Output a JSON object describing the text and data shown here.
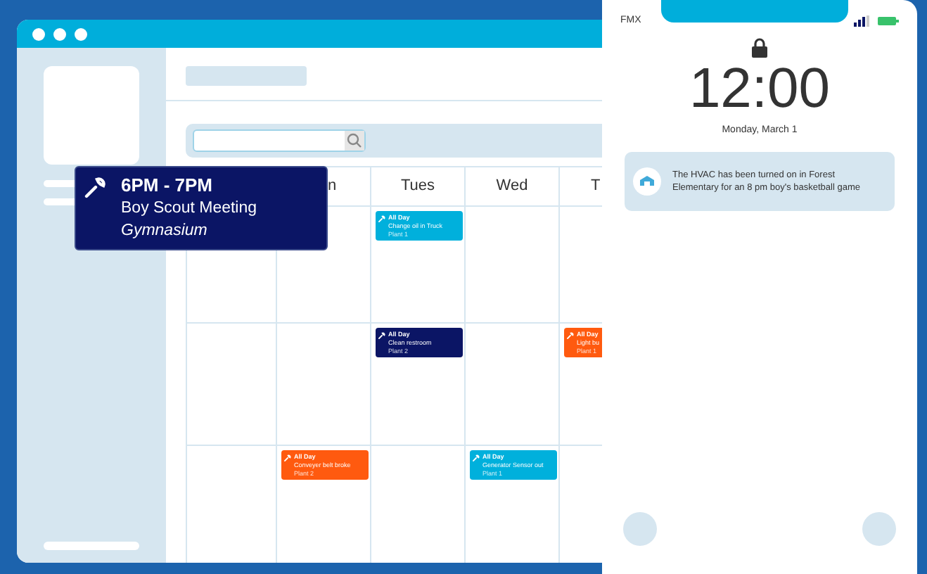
{
  "tooltip": {
    "time": "6PM - 7PM",
    "title": "Boy Scout Meeting",
    "location": "Gymnasium"
  },
  "calendar": {
    "days": [
      "n",
      "Tues",
      "Wed",
      "T"
    ],
    "weeks": [
      {
        "cells": [
          [],
          [],
          [
            {
              "label": "All Day",
              "title": "Change oil in Truck",
              "place": "Plant 1",
              "color": "#00b0dc"
            }
          ],
          [],
          []
        ]
      },
      {
        "cells": [
          [],
          [],
          [
            {
              "label": "All Day",
              "title": "Clean restroom",
              "place": "Plant 2",
              "color": "#0b1565"
            }
          ],
          [],
          [
            {
              "label": "All Day",
              "title": "Light bu",
              "place": "Plant 1",
              "color": "#ff5a0f"
            }
          ]
        ]
      },
      {
        "cells": [
          [],
          [
            {
              "label": "All Day",
              "title": "Conveyer belt broke",
              "place": "Plant 2",
              "color": "#ff5a0f"
            }
          ],
          [],
          [
            {
              "label": "All Day",
              "title": "Generator Sensor out",
              "place": "Plant 1",
              "color": "#00b0dc"
            }
          ],
          []
        ]
      }
    ]
  },
  "phone": {
    "carrier": "FMX",
    "time": "12:00",
    "date": "Monday, March 1",
    "notification": "The HVAC has been turned on in Forest Elementary for an 8 pm boy's basketball game"
  }
}
